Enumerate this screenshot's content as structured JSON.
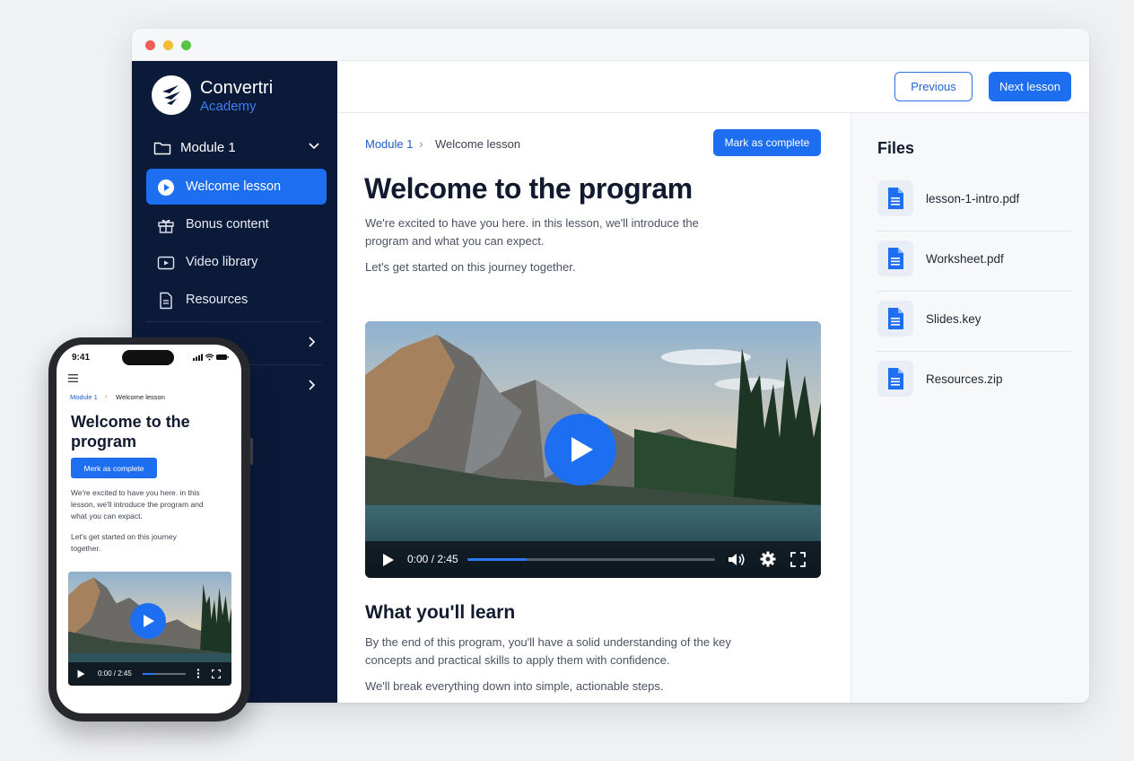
{
  "window": {
    "brand": {
      "name": "Convertri",
      "sub": "Academy"
    },
    "sidebar": {
      "module_label": "Module 1",
      "items": [
        {
          "label": "Welcome lesson",
          "icon": "play-circle-icon",
          "active": true
        },
        {
          "label": "Bonus content",
          "icon": "gift-icon",
          "active": false
        },
        {
          "label": "Video library",
          "icon": "video-icon",
          "active": false
        },
        {
          "label": "Resources",
          "icon": "document-icon",
          "active": false
        }
      ]
    },
    "topbar": {
      "previous_label": "Previous",
      "next_label": "Next lesson"
    },
    "main": {
      "breadcrumb": {
        "module": "Module 1",
        "current": "Welcome lesson",
        "separator": "›"
      },
      "mark_complete_label": "Mark as complete",
      "title": "Welcome to the program",
      "intro": "We're excited to have you here. in this lesson, we'll introduce the program and what you can expect.",
      "intro2": "Let's get started on this journey together.",
      "video": {
        "time": "0:00 / 2:45",
        "progress": 0.24
      },
      "section_title": "What you'll learn",
      "section_body": "By the end of this program, you'll have a solid understanding of the key concepts and practical skills to apply them with confidence.",
      "section_body2": "We'll break everything down into simple, actionable steps."
    },
    "files": {
      "title": "Files",
      "items": [
        {
          "name": "lesson-1-intro.pdf",
          "icon": "file-icon"
        },
        {
          "name": "Worksheet.pdf",
          "icon": "file-icon"
        },
        {
          "name": "Slides.key",
          "icon": "file-icon"
        },
        {
          "name": "Resources.zip",
          "icon": "file-icon"
        }
      ]
    }
  },
  "phone": {
    "time": "9:41",
    "breadcrumb": {
      "module": "Module 1",
      "current": "Welcome lesson",
      "separator": "›"
    },
    "title": "Welcome to the program",
    "mark_complete_label": "Merk as complete",
    "intro": "We're excited to have you here. in this lesson, we'll introduce the program and what you can expact.",
    "intro2": "Let's get started on this journey together.",
    "video": {
      "time": "0:00 / 2:45",
      "progress": 0.3
    }
  },
  "colors": {
    "accent": "#1d6ef0",
    "sidebar_bg": "#0c1a3a",
    "link": "#1d5ec9"
  }
}
